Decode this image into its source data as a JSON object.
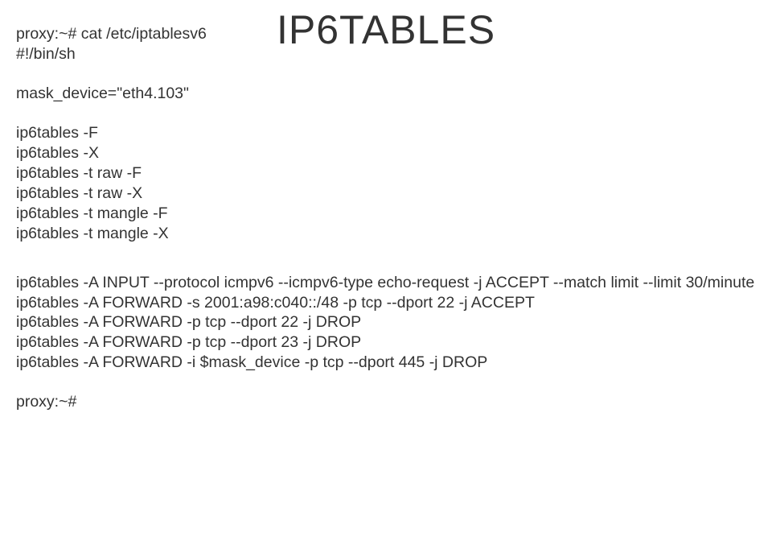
{
  "title": "IP6TABLES",
  "blocks": {
    "header": "proxy:~# cat /etc/iptablesv6\n#!/bin/sh",
    "maskdevice": "mask_device=\"eth4.103\"",
    "flush": "ip6tables -F\nip6tables -X\nip6tables -t raw -F\nip6tables -t raw -X\nip6tables -t mangle -F\nip6tables -t mangle -X",
    "rules": "ip6tables -A INPUT --protocol icmpv6 --icmpv6-type echo-request -j ACCEPT --match limit --limit 30/minute\nip6tables -A FORWARD -s 2001:a98:c040::/48 -p tcp --dport 22 -j ACCEPT\nip6tables -A FORWARD -p tcp --dport 22 -j DROP\nip6tables -A FORWARD -p tcp --dport 23 -j DROP\nip6tables -A FORWARD -i $mask_device -p tcp --dport 445 -j DROP",
    "prompt": "proxy:~#"
  }
}
